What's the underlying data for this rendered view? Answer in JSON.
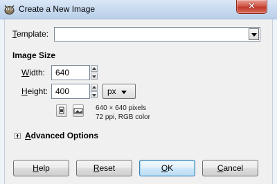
{
  "window": {
    "title": "Create a New Image",
    "close_glyph": "✕",
    "icon": "gimp-icon"
  },
  "template": {
    "label": "Template:",
    "mnemonic": "T",
    "label_rest": "emplate:",
    "value": ""
  },
  "image_size": {
    "heading": "Image Size",
    "width": {
      "mnemonic": "W",
      "label_rest": "idth:",
      "value": "640"
    },
    "height": {
      "mnemonic": "H",
      "label_rest": "eight:",
      "value": "400"
    },
    "unit": "px",
    "info_line1": "640 × 640 pixels",
    "info_line2": "72 ppi, RGB color"
  },
  "advanced": {
    "mnemonic": "A",
    "label_rest": "dvanced Options",
    "expanded": false
  },
  "buttons": {
    "help": {
      "mnemonic": "H",
      "rest": "elp"
    },
    "reset": {
      "mnemonic": "R",
      "rest": "eset"
    },
    "ok": {
      "mnemonic": "O",
      "rest": "K"
    },
    "cancel": {
      "mnemonic": "C",
      "rest": "ancel"
    }
  },
  "colors": {
    "titlebar": "#c6d9ef",
    "close": "#c1392b",
    "default_button_border": "#3c7fb1"
  }
}
